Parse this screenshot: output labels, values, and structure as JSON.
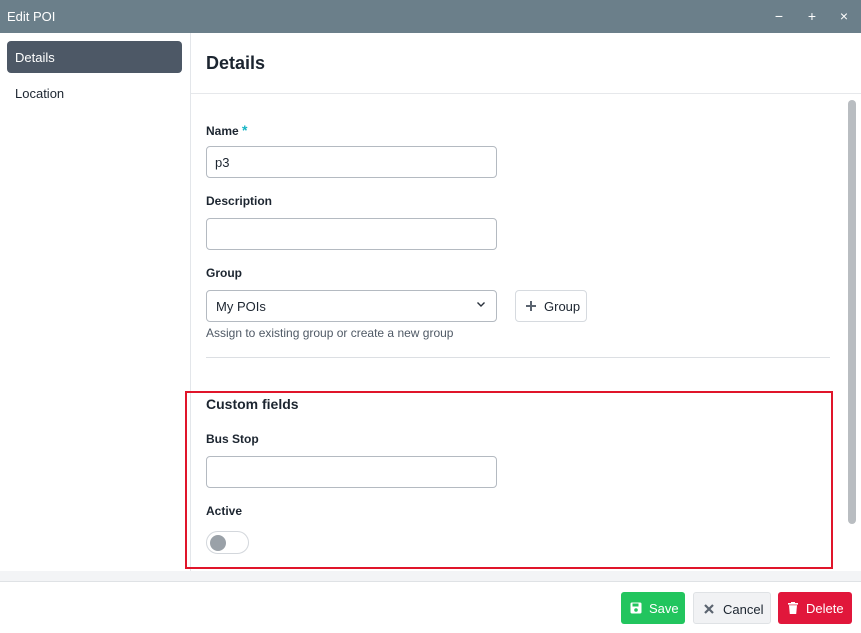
{
  "window": {
    "title": "Edit POI",
    "minimize_label": "−",
    "maximize_label": "+",
    "close_label": "×"
  },
  "sidebar": {
    "items": [
      {
        "label": "Details",
        "active": true
      },
      {
        "label": "Location",
        "active": false
      }
    ]
  },
  "main": {
    "title": "Details",
    "fields": {
      "name": {
        "label": "Name",
        "required_mark": "*",
        "value": "p3"
      },
      "description": {
        "label": "Description",
        "value": ""
      },
      "group": {
        "label": "Group",
        "selected": "My POIs",
        "add_button_label": "Group",
        "hint": "Assign to existing group or create a new group"
      }
    },
    "custom_fields": {
      "title": "Custom fields",
      "bus_stop": {
        "label": "Bus Stop",
        "value": ""
      },
      "active": {
        "label": "Active",
        "on": false
      }
    }
  },
  "footer": {
    "save_label": "Save",
    "cancel_label": "Cancel",
    "delete_label": "Delete"
  },
  "colors": {
    "titlebar": "#6b7f8a",
    "nav_active": "#4d5866",
    "save": "#22c55e",
    "delete": "#e1173b",
    "required": "#16b5c4",
    "highlight_border": "#e0152a"
  }
}
